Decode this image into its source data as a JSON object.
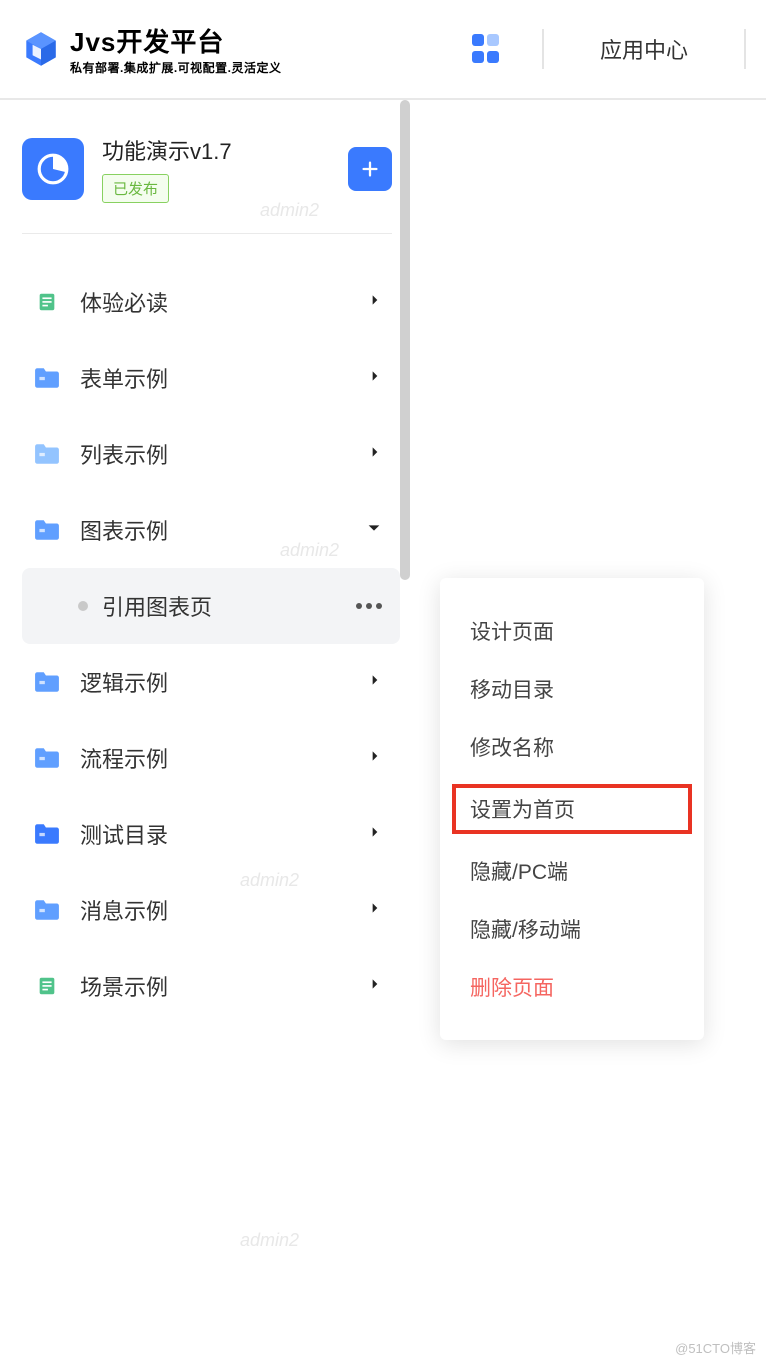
{
  "header": {
    "title": "Jvs开发平台",
    "subtitle": "私有部署.集成扩展.可视配置.灵活定义",
    "app_center": "应用中心"
  },
  "app": {
    "title": "功能演示v1.7",
    "status": "已发布"
  },
  "tree": [
    {
      "label": "体验必读",
      "iconColor": "#50c38a",
      "expanded": false,
      "type": "doc"
    },
    {
      "label": "表单示例",
      "iconColor": "#609fff",
      "expanded": false,
      "type": "folder"
    },
    {
      "label": "列表示例",
      "iconColor": "#93c4ff",
      "expanded": false,
      "type": "folder"
    },
    {
      "label": "图表示例",
      "iconColor": "#609fff",
      "expanded": true,
      "type": "folder",
      "children": [
        {
          "label": "引用图表页",
          "selected": true
        }
      ]
    },
    {
      "label": "逻辑示例",
      "iconColor": "#609fff",
      "expanded": false,
      "type": "folder"
    },
    {
      "label": "流程示例",
      "iconColor": "#609fff",
      "expanded": false,
      "type": "folder"
    },
    {
      "label": "测试目录",
      "iconColor": "#3a7afe",
      "expanded": false,
      "type": "folder"
    },
    {
      "label": "消息示例",
      "iconColor": "#609fff",
      "expanded": false,
      "type": "folder"
    },
    {
      "label": "场景示例",
      "iconColor": "#50c38a",
      "expanded": false,
      "type": "doc"
    }
  ],
  "context_menu": [
    {
      "label": "设计页面"
    },
    {
      "label": "移动目录"
    },
    {
      "label": "修改名称"
    },
    {
      "label": "设置为首页",
      "highlighted": true
    },
    {
      "label": "隐藏/PC端"
    },
    {
      "label": "隐藏/移动端"
    },
    {
      "label": "删除页面",
      "danger": true
    }
  ],
  "watermark": "admin2",
  "credit": "@51CTO博客"
}
